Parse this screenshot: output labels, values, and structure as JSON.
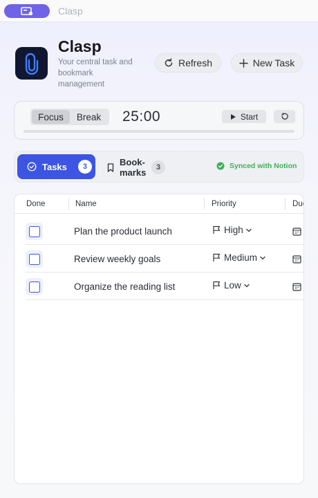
{
  "window": {
    "title": "Clasp"
  },
  "header": {
    "app_name": "Clasp",
    "description": "Your central task and bookmark management",
    "refresh_label": "Refresh",
    "new_task_label": "New Task"
  },
  "timer": {
    "modes": [
      "Focus",
      "Break"
    ],
    "active_mode": "Focus",
    "time": "25:00",
    "start_label": "Start",
    "progress_fraction": 0
  },
  "tabs": {
    "tasks_label": "Tasks",
    "tasks_count": "3",
    "bookmarks_label": "Book-marks",
    "bookmarks_count": "3",
    "sync_status": "Synced with Notion"
  },
  "table": {
    "columns": [
      "Done",
      "Name",
      "Priority",
      "Due"
    ],
    "rows": [
      {
        "name": "Plan the product launch",
        "priority": "High",
        "done": false
      },
      {
        "name": "Review weekly goals",
        "priority": "Medium",
        "done": false
      },
      {
        "name": "Organize the reading list",
        "priority": "Low",
        "done": false
      }
    ]
  },
  "icons": {
    "app_chip": "dashboard-icon",
    "logo": "paperclip-icon",
    "refresh": "refresh-icon",
    "new_task": "plus-icon",
    "start": "play-icon",
    "reset": "reset-icon",
    "tasks_tab": "check-circle-icon",
    "bookmarks_tab": "bookmark-icon",
    "sync": "check-circle-filled-icon",
    "priority": "flag-icon",
    "due": "calendar-icon"
  },
  "colors": {
    "accent": "#3d55e2",
    "app_chip": "#6f63e6",
    "sync_green": "#3fae59"
  }
}
